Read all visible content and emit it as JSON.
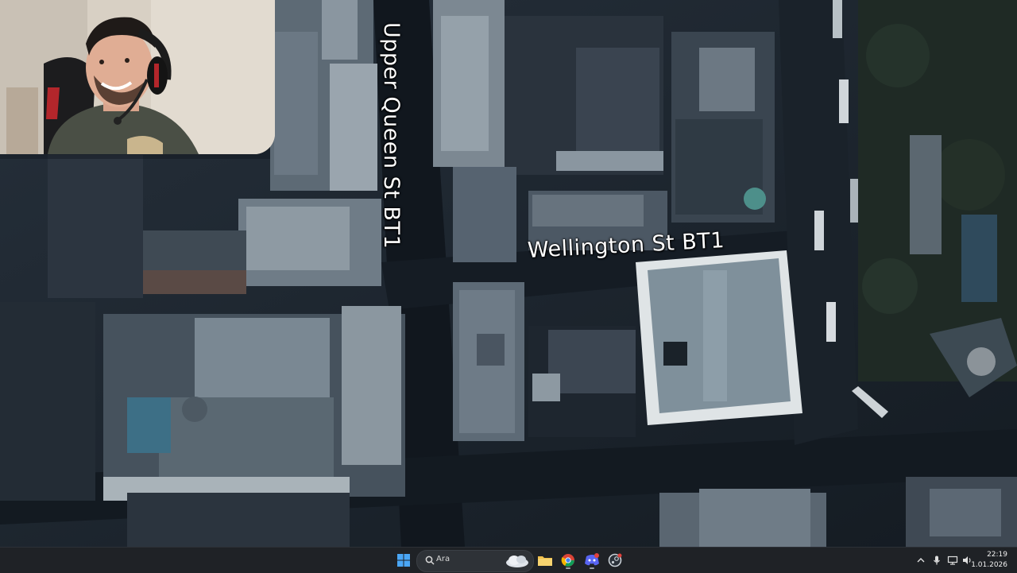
{
  "map": {
    "streets": {
      "upper_queen_st": "Upper Queen St BT1",
      "wellington_st": "Wellington St BT1"
    }
  },
  "webcam": {
    "description_icon": "streamer-webcam"
  },
  "taskbar": {
    "search_placeholder": "Ara",
    "apps": [
      "start-icon",
      "file-explorer-icon",
      "chrome-icon",
      "discord-icon",
      "steam-icon"
    ],
    "discord_badge_color": "#e0413b",
    "clock_time": "22:19",
    "clock_date": "1.01.2026"
  },
  "colors": {
    "taskbar_bg": "#1f2226",
    "start_blue": "#4aa6f5",
    "folder_yellow": "#f2c14e"
  }
}
